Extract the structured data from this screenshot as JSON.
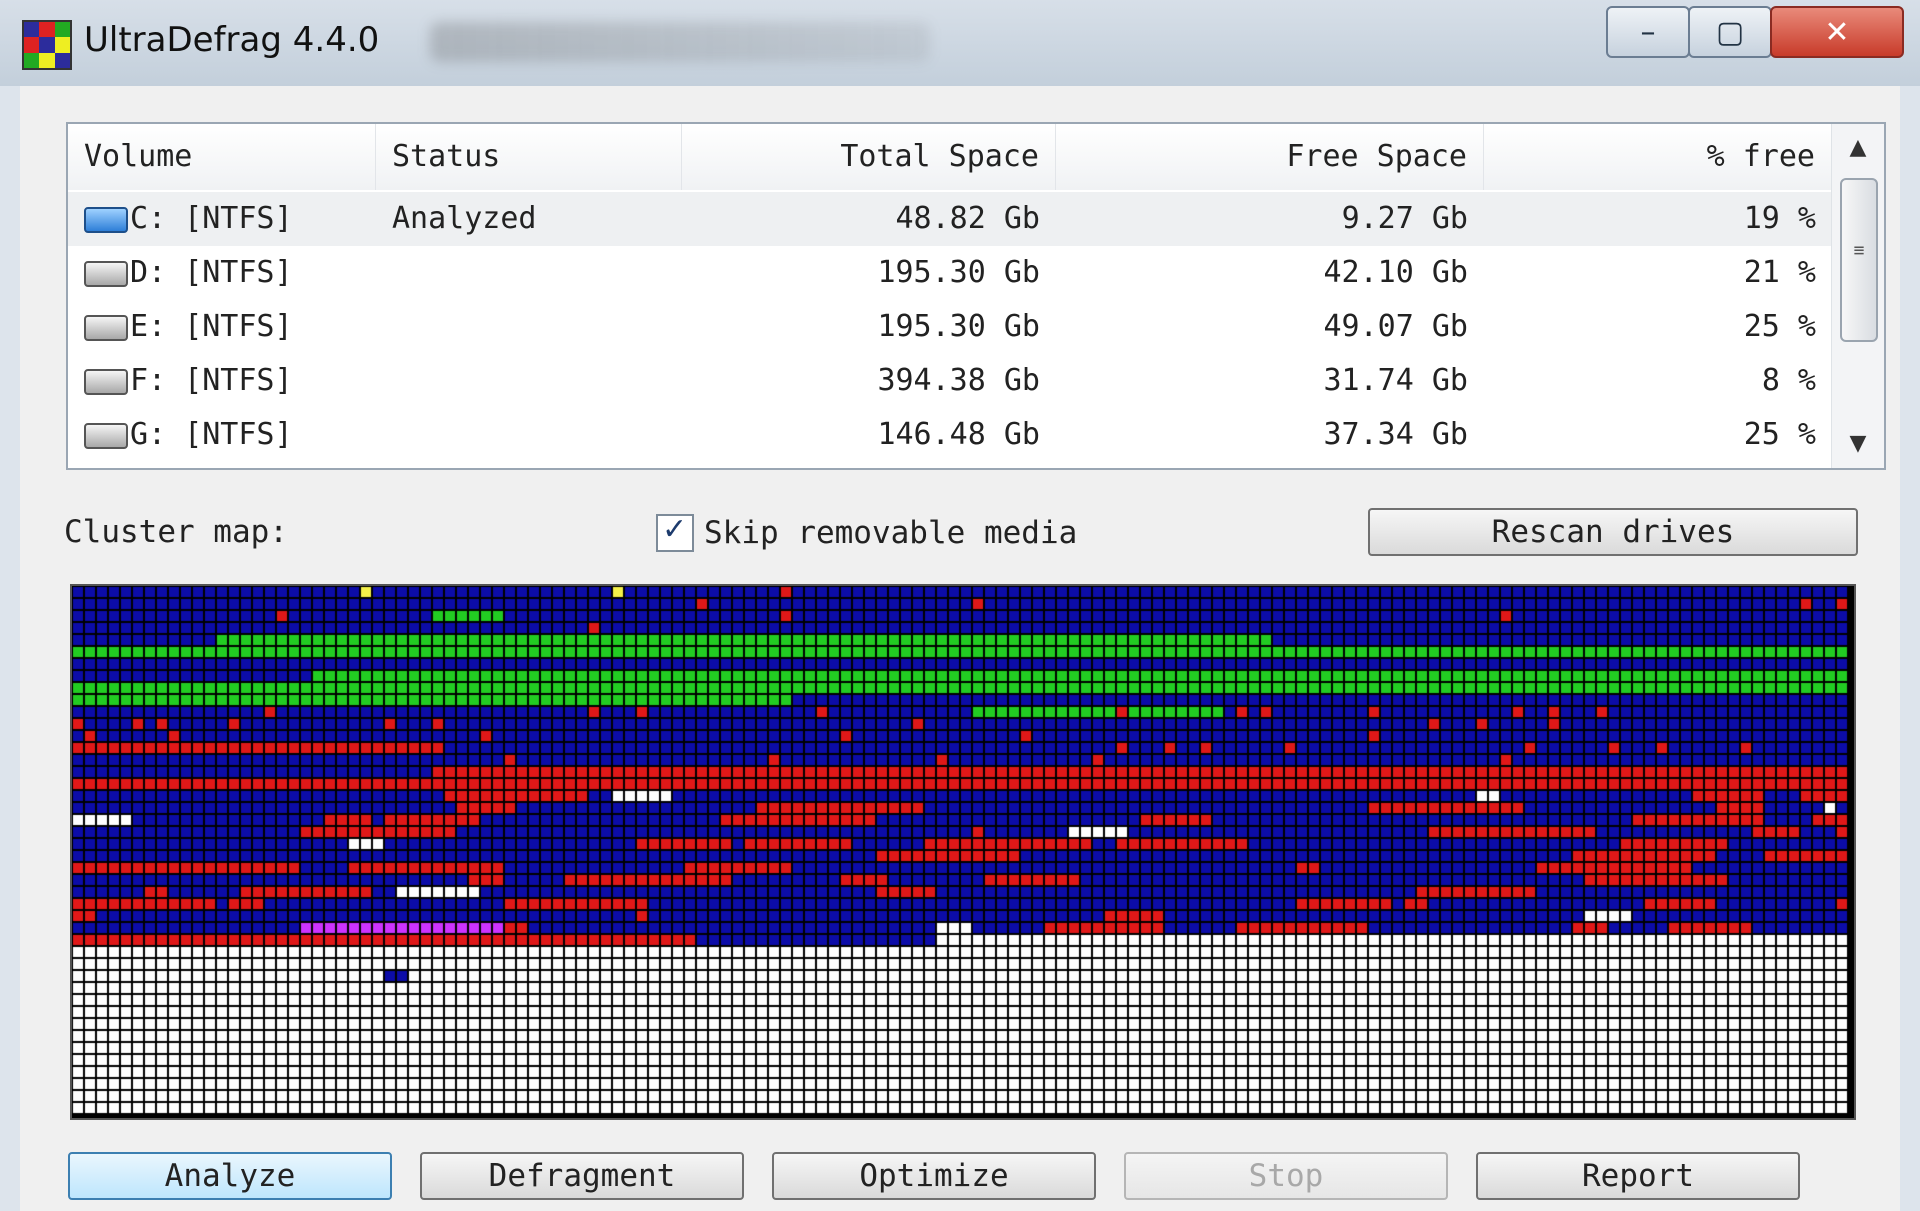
{
  "window": {
    "title": "UltraDefrag 4.4.0",
    "controls": {
      "minimize_icon": "minimize-icon",
      "maximize_icon": "maximize-icon",
      "close_icon": "close-icon"
    }
  },
  "volumes": {
    "columns": [
      "Volume",
      "Status",
      "Total Space",
      "Free Space",
      "% free"
    ],
    "rows": [
      {
        "volume": "C: [NTFS]",
        "status": "Analyzed",
        "total": "48.82 Gb",
        "free": "9.27 Gb",
        "pct": "19 %",
        "selected": true
      },
      {
        "volume": "D: [NTFS]",
        "status": "",
        "total": "195.30 Gb",
        "free": "42.10 Gb",
        "pct": "21 %"
      },
      {
        "volume": "E: [NTFS]",
        "status": "",
        "total": "195.30 Gb",
        "free": "49.07 Gb",
        "pct": "25 %"
      },
      {
        "volume": "F: [NTFS]",
        "status": "",
        "total": "394.38 Gb",
        "free": "31.74 Gb",
        "pct": "8 %"
      },
      {
        "volume": "G: [NTFS]",
        "status": "",
        "total": "146.48 Gb",
        "free": "37.34 Gb",
        "pct": "25 %"
      }
    ]
  },
  "cluster": {
    "label": "Cluster map:",
    "skip_label": "Skip removable media",
    "skip_checked": true,
    "rescan_label": "Rescan drives",
    "legend_colors": {
      "free": "#0c0ca8",
      "fragmented": "#e01818",
      "contiguous": "#22cc22",
      "unused": "#ffffff",
      "mft": "#cc33ff",
      "system": "#f4f04a"
    }
  },
  "actions": {
    "analyze": "Analyze",
    "defragment": "Defragment",
    "optimize": "Optimize",
    "stop": "Stop",
    "report": "Report"
  }
}
